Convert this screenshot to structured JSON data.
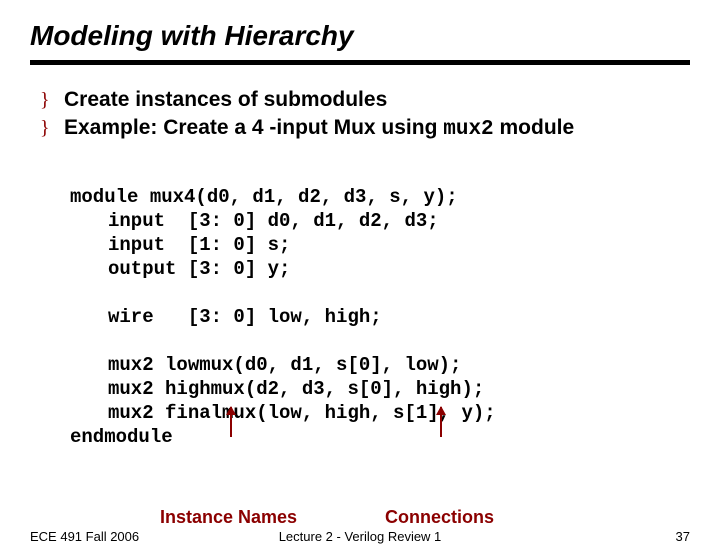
{
  "title": "Modeling with Hierarchy",
  "bullets": [
    {
      "text": "Create instances of submodules"
    },
    {
      "text_pre": "Example: Create a 4 -input Mux using ",
      "mono": "mux2",
      "text_post": " module"
    }
  ],
  "code": {
    "l1": "module mux4(d0, d1, d2, d3, s, y);",
    "l2": "input  [3: 0] d0, d1, d2, d3;",
    "l3": "input  [1: 0] s;",
    "l4": "output [3: 0] y;",
    "l5": "",
    "l6": "wire   [3: 0] low, high;",
    "l7": "",
    "l8": "mux2 lowmux(d0, d1, s[0], low);",
    "l9": "mux2 highmux(d2, d3, s[0], high);",
    "l10": "mux2 finalmux(low, high, s[1], y);",
    "l11": "endmodule"
  },
  "annot": {
    "instance_names": "Instance Names",
    "connections": "Connections"
  },
  "footer": {
    "left": "ECE 491 Fall 2006",
    "center": "Lecture 2 - Verilog Review 1",
    "right": "37"
  }
}
